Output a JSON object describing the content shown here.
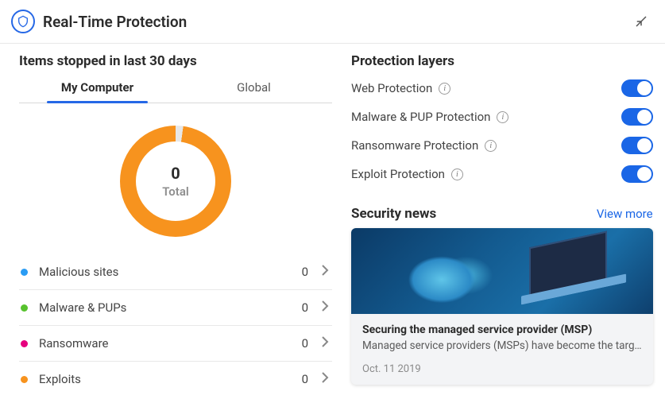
{
  "header": {
    "title": "Real-Time Protection"
  },
  "left": {
    "section_title": "Items stopped in last 30 days",
    "tabs": [
      {
        "label": "My Computer",
        "active": true
      },
      {
        "label": "Global",
        "active": false
      }
    ],
    "donut": {
      "value": "0",
      "label": "Total"
    },
    "categories": [
      {
        "label": "Malicious sites",
        "count": "0",
        "color": "#2a9cf4"
      },
      {
        "label": "Malware & PUPs",
        "count": "0",
        "color": "#57c22d"
      },
      {
        "label": "Ransomware",
        "count": "0",
        "color": "#e6007e"
      },
      {
        "label": "Exploits",
        "count": "0",
        "color": "#f7931e"
      }
    ]
  },
  "right": {
    "layers_title": "Protection layers",
    "layers": [
      {
        "label": "Web Protection",
        "on": true
      },
      {
        "label": "Malware & PUP Protection",
        "on": true
      },
      {
        "label": "Ransomware Protection",
        "on": true
      },
      {
        "label": "Exploit Protection",
        "on": true
      }
    ],
    "news_title": "Security news",
    "view_more": "View more",
    "news": {
      "title": "Securing the managed service provider (MSP)",
      "desc": "Managed service providers (MSPs) have become the targ…",
      "date": "Oct. 11 2019"
    }
  }
}
